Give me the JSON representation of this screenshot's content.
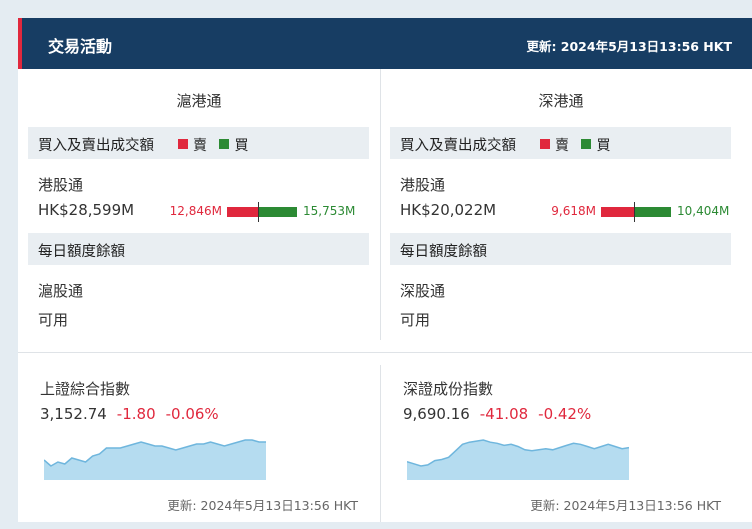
{
  "header": {
    "title": "交易活動",
    "updated": "更新: 2024年5月13日13:56 HKT"
  },
  "legend": {
    "sell": "賣",
    "buy": "買"
  },
  "columns": [
    {
      "title": "滬港通",
      "turnover_label": "買入及賣出成交額",
      "stock_connect": {
        "name": "港股通",
        "total": "HK$28,599M",
        "sell": "12,846M",
        "buy": "15,753M",
        "sell_value": 12846,
        "buy_value": 15753
      },
      "quota_label": "每日額度餘額",
      "quota": {
        "name": "滬股通",
        "status": "可用"
      }
    },
    {
      "title": "深港通",
      "turnover_label": "買入及賣出成交額",
      "stock_connect": {
        "name": "港股通",
        "total": "HK$20,022M",
        "sell": "9,618M",
        "buy": "10,404M",
        "sell_value": 9618,
        "buy_value": 10404
      },
      "quota_label": "每日額度餘額",
      "quota": {
        "name": "深股通",
        "status": "可用"
      }
    }
  ],
  "indices": [
    {
      "name": "上證綜合指數",
      "price": "3,152.74",
      "change": "-1.80",
      "pct": "-0.06%",
      "updated": "更新: 2024年5月13日13:56 HKT",
      "spark": [
        3147,
        3144,
        3146,
        3145,
        3148,
        3147,
        3146,
        3149,
        3150,
        3153,
        3153,
        3153,
        3154,
        3155,
        3156,
        3155,
        3154,
        3154,
        3153,
        3152,
        3153,
        3154,
        3155,
        3155,
        3156,
        3155,
        3154,
        3155,
        3156,
        3157,
        3157,
        3156,
        3156
      ]
    },
    {
      "name": "深證成份指數",
      "price": "9,690.16",
      "change": "-41.08",
      "pct": "-0.42%",
      "updated": "更新: 2024年5月13日13:56 HKT",
      "spark": [
        9682,
        9680,
        9678,
        9679,
        9683,
        9684,
        9686,
        9692,
        9698,
        9700,
        9701,
        9702,
        9700,
        9699,
        9697,
        9698,
        9696,
        9693,
        9692,
        9693,
        9694,
        9693,
        9695,
        9697,
        9699,
        9698,
        9696,
        9694,
        9696,
        9698,
        9696,
        9694,
        9695
      ]
    }
  ],
  "colors": {
    "header_bg": "#173d63",
    "accent_red": "#e0283d",
    "buy_green": "#2c8a34",
    "spark_fill": "#b5dcf0",
    "spark_line": "#6fb6dd"
  }
}
